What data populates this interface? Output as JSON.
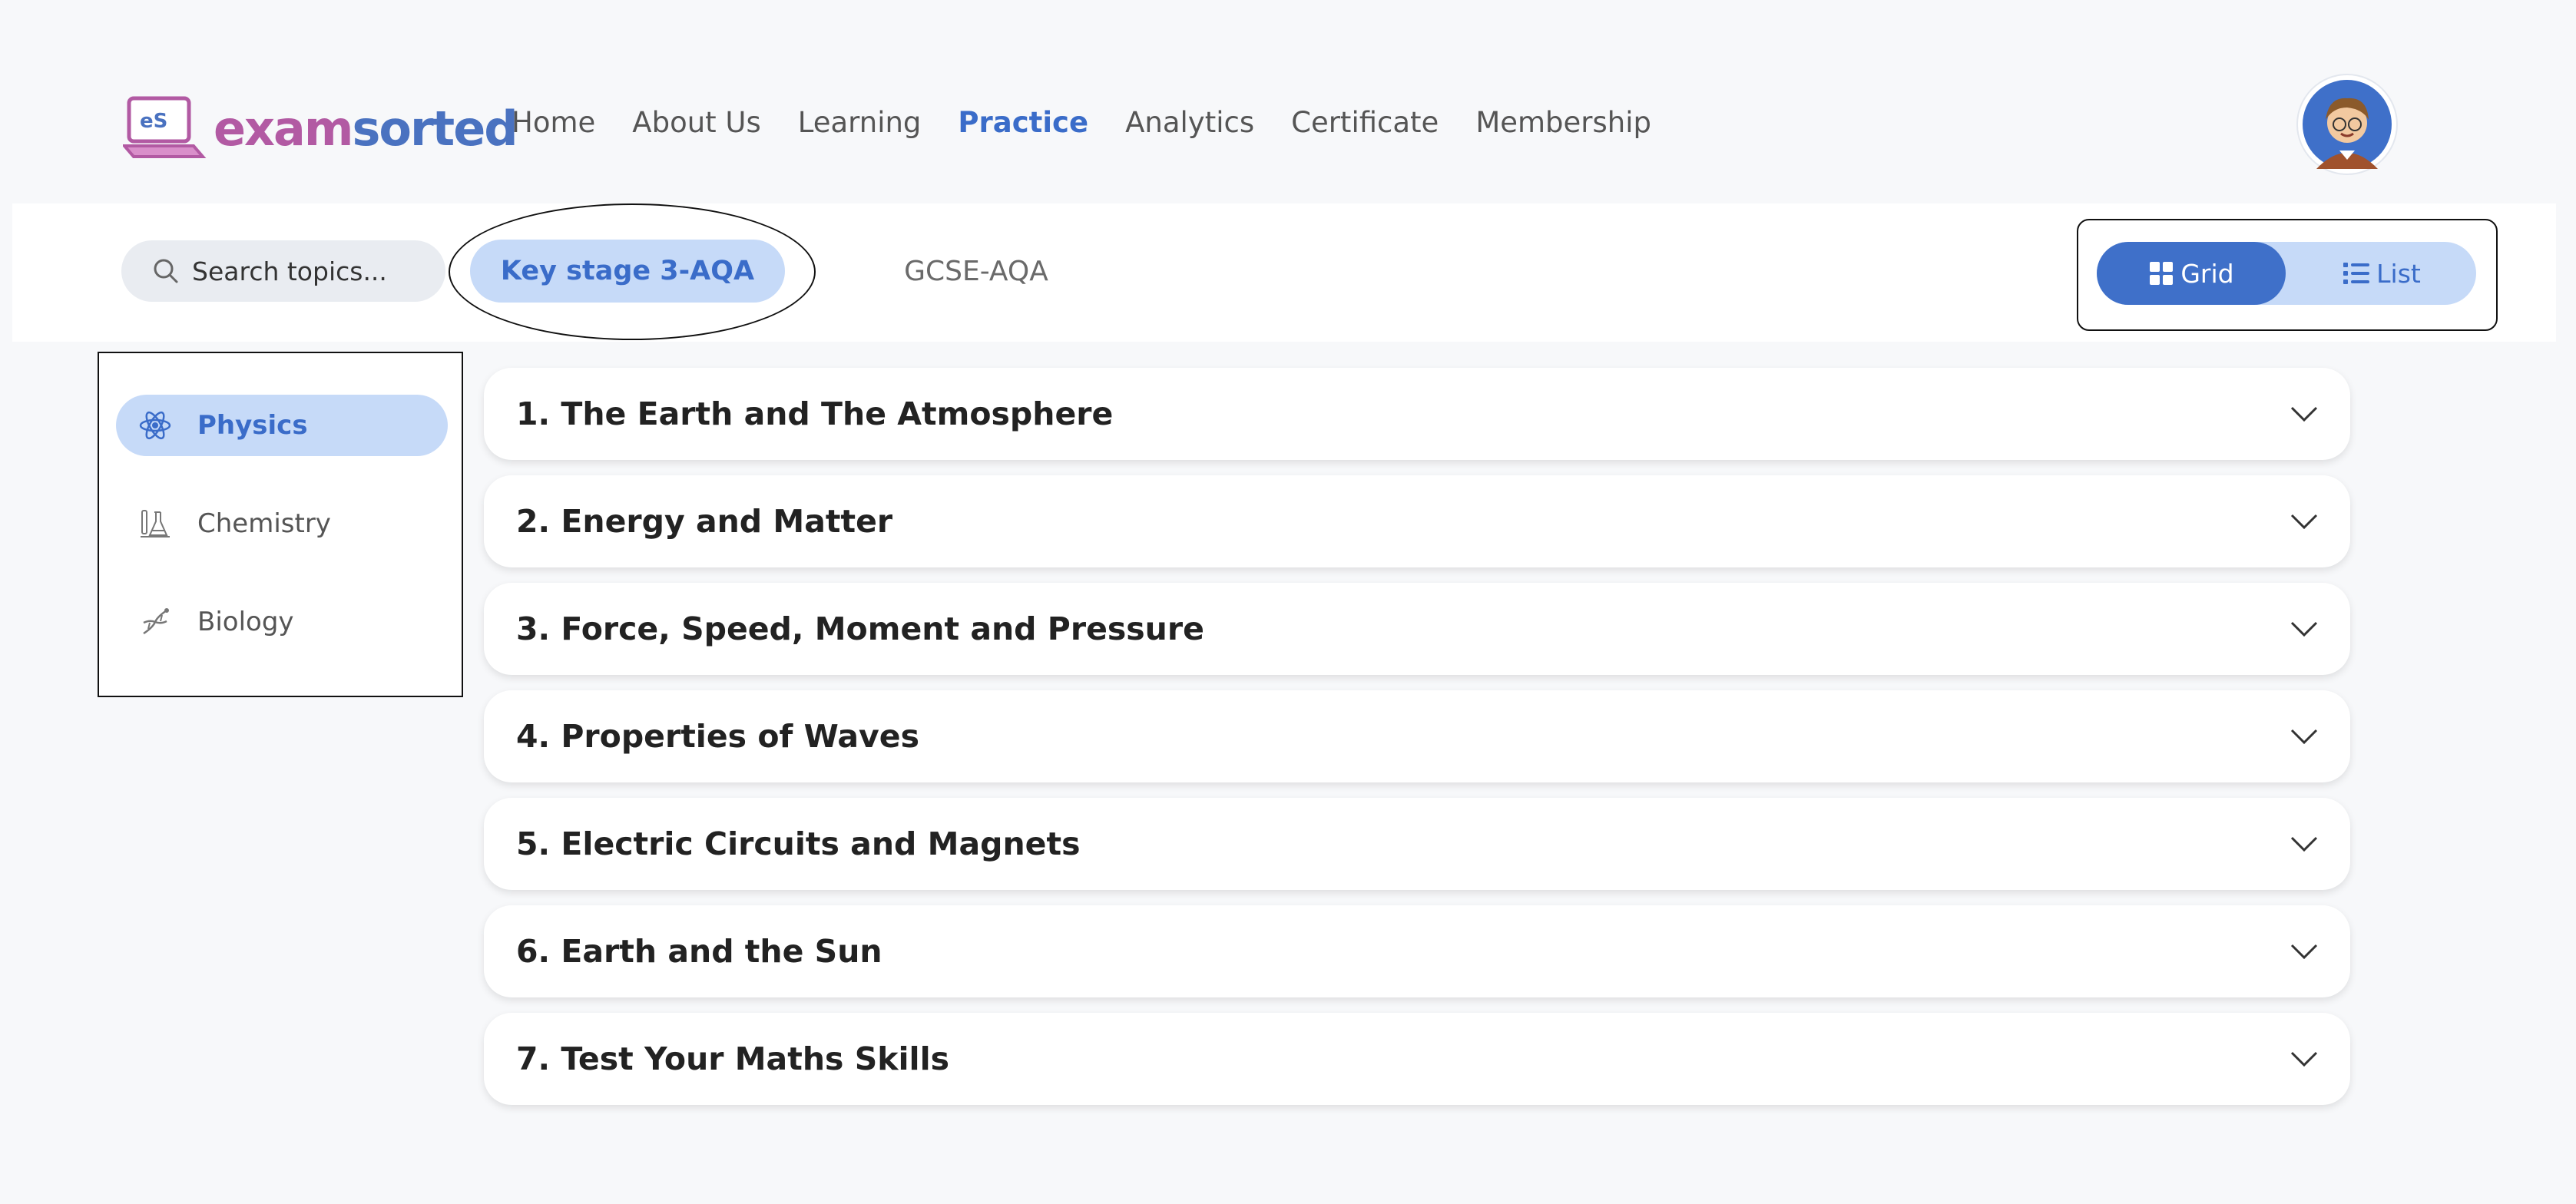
{
  "brand": {
    "logo_text_part1": "exam",
    "logo_text_part2": "sorted",
    "logo_mark": "eS"
  },
  "nav": {
    "items": [
      {
        "label": "Home",
        "active": false
      },
      {
        "label": "About Us",
        "active": false
      },
      {
        "label": "Learning",
        "active": false
      },
      {
        "label": "Practice",
        "active": true
      },
      {
        "label": "Analytics",
        "active": false
      },
      {
        "label": "Certificate",
        "active": false
      },
      {
        "label": "Membership",
        "active": false
      }
    ]
  },
  "user": {
    "avatar_icon": "cartoon-boy-avatar"
  },
  "toolbar": {
    "search_placeholder": "Search topics...",
    "levels": [
      {
        "label": "Key stage 3-AQA",
        "active": true
      },
      {
        "label": "GCSE-AQA",
        "active": false
      }
    ],
    "view_toggle": {
      "grid_label": "Grid",
      "list_label": "List",
      "selected": "Grid"
    }
  },
  "sidebar": {
    "subjects": [
      {
        "label": "Physics",
        "icon": "atom-icon",
        "active": true
      },
      {
        "label": "Chemistry",
        "icon": "flask-icon",
        "active": false
      },
      {
        "label": "Biology",
        "icon": "dna-icon",
        "active": false
      }
    ]
  },
  "topics": [
    "1. The Earth and The Atmosphere",
    "2. Energy and Matter",
    "3. Force, Speed, Moment and Pressure",
    "4. Properties of Waves",
    "5. Electric Circuits and Magnets",
    "6. Earth and the Sun",
    "7. Test Your Maths Skills"
  ],
  "colors": {
    "accent": "#3a6cc9",
    "accent_light": "#c6daf8",
    "brand_pink": "#b25aa3",
    "background": "#f7f8fa"
  }
}
